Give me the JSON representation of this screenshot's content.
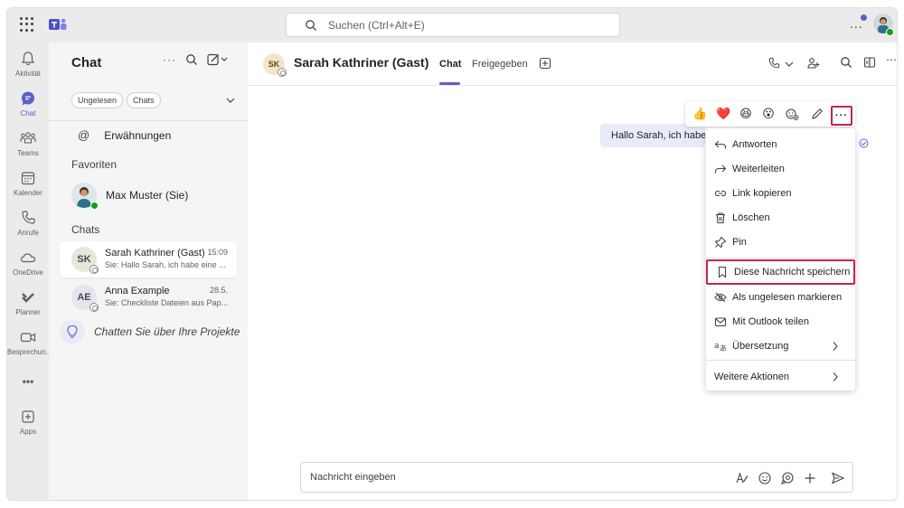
{
  "search": {
    "placeholder": "Suchen (Ctrl+Alt+E)"
  },
  "rail": [
    {
      "label": "Aktivität",
      "icon": "bell-icon"
    },
    {
      "label": "Chat",
      "icon": "chat-icon",
      "active": true
    },
    {
      "label": "Teams",
      "icon": "teams-icon"
    },
    {
      "label": "Kalender",
      "icon": "calendar-icon"
    },
    {
      "label": "Anrufe",
      "icon": "phone-icon"
    },
    {
      "label": "OneDrive",
      "icon": "cloud-icon"
    },
    {
      "label": "Planner",
      "icon": "planner-icon"
    },
    {
      "label": "Besprechun...",
      "icon": "video-icon"
    },
    {
      "label": "Apps",
      "icon": "apps-icon"
    }
  ],
  "rail_more": "•••",
  "list": {
    "title": "Chat",
    "filters": [
      "Ungelesen",
      "Chats"
    ],
    "mentions": "Erwähnungen",
    "favorites_label": "Favoriten",
    "favorite_name": "Max Muster (Sie)",
    "chats_label": "Chats",
    "chats": [
      {
        "initials": "SK",
        "name": "Sarah Kathriner (Gast)",
        "time": "15:09",
        "preview": "Sie: Hallo Sarah, ich habe eine ..."
      },
      {
        "initials": "AE",
        "name": "Anna Example",
        "time": "28.5.",
        "preview": "Sie: Checkliste Dateien aus Pap..."
      }
    ],
    "idea": "Chatten Sie über Ihre Projekte"
  },
  "header": {
    "initials": "SK",
    "name": "Sarah Kathriner (Gast)",
    "tabs": [
      "Chat",
      "Freigegeben"
    ]
  },
  "message": {
    "text": "Hallo Sarah, ich habe"
  },
  "reactions": [
    "👍",
    "❤️",
    "😆",
    "😮"
  ],
  "menu": {
    "items": [
      {
        "label": "Antworten",
        "icon": "reply-icon"
      },
      {
        "label": "Weiterleiten",
        "icon": "forward-icon"
      },
      {
        "label": "Link kopieren",
        "icon": "link-icon"
      },
      {
        "label": "Löschen",
        "icon": "trash-icon"
      },
      {
        "label": "Pin",
        "icon": "pin-icon"
      },
      {
        "label": "Diese Nachricht speichern",
        "icon": "bookmark-icon"
      },
      {
        "label": "Als ungelesen markieren",
        "icon": "unread-icon"
      },
      {
        "label": "Mit Outlook teilen",
        "icon": "mail-icon"
      },
      {
        "label": "Übersetzung",
        "icon": "translate-icon"
      },
      {
        "label": "Weitere Aktionen",
        "icon": ""
      }
    ]
  },
  "composer": {
    "placeholder": "Nachricht eingeben"
  },
  "colors": {
    "accent": "#5b5fc7",
    "highlight": "#c3274e",
    "bubble": "#e8ebfa",
    "presence": "#13a10e"
  }
}
